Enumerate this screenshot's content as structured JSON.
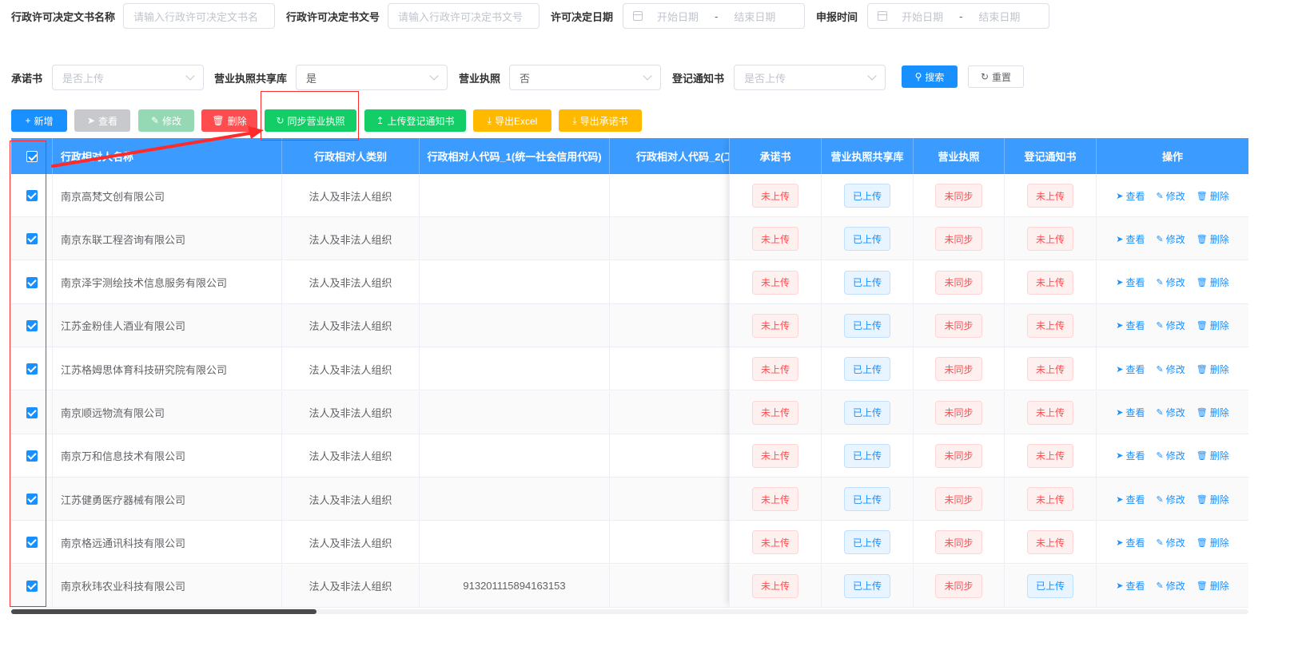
{
  "filters": {
    "row1": [
      {
        "label": "行政许可决定文书名称",
        "placeholder": "请输入行政许可决定文书名"
      },
      {
        "label": "行政许可决定书文号",
        "placeholder": "请输入行政许可决定书文号"
      },
      {
        "label": "许可决定日期",
        "start": "开始日期",
        "sep": "-",
        "end": "结束日期"
      },
      {
        "label": "申报时间",
        "start": "开始日期",
        "sep": "-",
        "end": "结束日期"
      }
    ],
    "row2": [
      {
        "label": "承诺书",
        "value": "是否上传",
        "is_placeholder": true
      },
      {
        "label": "营业执照共享库",
        "value": "是",
        "is_placeholder": false
      },
      {
        "label": "营业执照",
        "value": "否",
        "is_placeholder": false
      },
      {
        "label": "登记通知书",
        "value": "是否上传",
        "is_placeholder": true
      }
    ],
    "search_label": "搜索",
    "reset_label": "重置"
  },
  "toolbar": {
    "add": "新增",
    "view": "查看",
    "edit": "修改",
    "delete": "删除",
    "sync": "同步营业执照",
    "upload": "上传登记通知书",
    "export_excel": "导出Excel",
    "export_promise": "导出承诺书"
  },
  "table": {
    "columns": [
      "行政相对人名称",
      "行政相对人类别",
      "行政相对人代码_1(统一社会信用代码)",
      "行政相对人代码_2(工",
      "承诺书",
      "营业执照共享库",
      "营业执照",
      "登记通知书",
      "操作"
    ],
    "actions": {
      "view": "查看",
      "edit": "修改",
      "delete": "删除"
    },
    "rows": [
      {
        "name": "南京高梵文创有限公司",
        "type": "法人及非法人组织",
        "code1": "",
        "code2": "",
        "promise": "未上传",
        "shared": "已上传",
        "license": "未同步",
        "notice": "未上传"
      },
      {
        "name": "南京东联工程咨询有限公司",
        "type": "法人及非法人组织",
        "code1": "",
        "code2": "",
        "promise": "未上传",
        "shared": "已上传",
        "license": "未同步",
        "notice": "未上传"
      },
      {
        "name": "南京泽宇测绘技术信息服务有限公司",
        "type": "法人及非法人组织",
        "code1": "",
        "code2": "",
        "promise": "未上传",
        "shared": "已上传",
        "license": "未同步",
        "notice": "未上传"
      },
      {
        "name": "江苏金粉佳人酒业有限公司",
        "type": "法人及非法人组织",
        "code1": "",
        "code2": "",
        "promise": "未上传",
        "shared": "已上传",
        "license": "未同步",
        "notice": "未上传"
      },
      {
        "name": "江苏格姆思体育科技研究院有限公司",
        "type": "法人及非法人组织",
        "code1": "",
        "code2": "",
        "promise": "未上传",
        "shared": "已上传",
        "license": "未同步",
        "notice": "未上传"
      },
      {
        "name": "南京顺远物流有限公司",
        "type": "法人及非法人组织",
        "code1": "",
        "code2": "",
        "promise": "未上传",
        "shared": "已上传",
        "license": "未同步",
        "notice": "未上传"
      },
      {
        "name": "南京万和信息技术有限公司",
        "type": "法人及非法人组织",
        "code1": "",
        "code2": "",
        "promise": "未上传",
        "shared": "已上传",
        "license": "未同步",
        "notice": "未上传"
      },
      {
        "name": "江苏健勇医疗器械有限公司",
        "type": "法人及非法人组织",
        "code1": "",
        "code2": "",
        "promise": "未上传",
        "shared": "已上传",
        "license": "未同步",
        "notice": "未上传"
      },
      {
        "name": "南京格远通讯科技有限公司",
        "type": "法人及非法人组织",
        "code1": "",
        "code2": "",
        "promise": "未上传",
        "shared": "已上传",
        "license": "未同步",
        "notice": "未上传"
      },
      {
        "name": "南京秋玮农业科技有限公司",
        "type": "法人及非法人组织",
        "code1": "913201115894163153",
        "code2": "",
        "promise": "未上传",
        "shared": "已上传",
        "license": "未同步",
        "notice": "已上传"
      }
    ]
  },
  "colors": {
    "primary": "#1890ff",
    "header_bg": "#3b9bff",
    "danger": "#ff4d4f",
    "success": "#13ce66",
    "warning": "#ffba00",
    "annotation": "#ff2a2a"
  }
}
